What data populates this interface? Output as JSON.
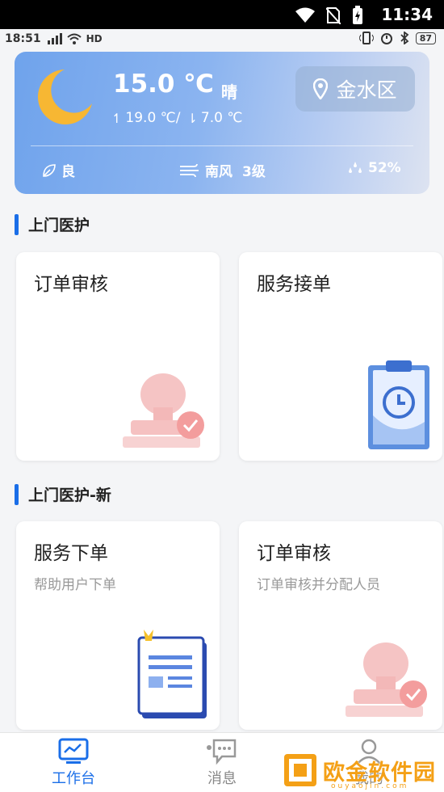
{
  "system": {
    "time": "11:34"
  },
  "status": {
    "time": "18:51",
    "battery": "87",
    "network": "HD"
  },
  "weather": {
    "temperature": "15.0 ℃",
    "condition": "晴",
    "high": "19.0 ℃/",
    "low": "7.0 ℃",
    "location": "金水区",
    "air_quality": "良",
    "wind": "南风",
    "wind_level": "3级",
    "humidity": "52%"
  },
  "sections": [
    {
      "title": "上门医护",
      "cards": [
        {
          "title": "订单审核",
          "subtitle": "",
          "icon": "stamp-icon"
        },
        {
          "title": "服务接单",
          "subtitle": "",
          "icon": "clipboard-clock-icon"
        }
      ]
    },
    {
      "title": "上门医护-新",
      "cards": [
        {
          "title": "服务下单",
          "subtitle": "帮助用户下单",
          "icon": "document-icon"
        },
        {
          "title": "订单审核",
          "subtitle": "订单审核并分配人员",
          "icon": "stamp-icon"
        }
      ]
    }
  ],
  "nav": {
    "items": [
      {
        "label": "工作台",
        "icon": "monitor-icon",
        "active": true
      },
      {
        "label": "消息",
        "icon": "chat-icon",
        "active": false
      },
      {
        "label": "我的",
        "icon": "user-icon",
        "active": false
      }
    ]
  },
  "watermark": {
    "text": "欧金软件园",
    "sub": "ouyaojin.com"
  },
  "colors": {
    "accent": "#1a6ee8",
    "moon": "#f7b733",
    "weather_bg": "#7aa9ee"
  }
}
